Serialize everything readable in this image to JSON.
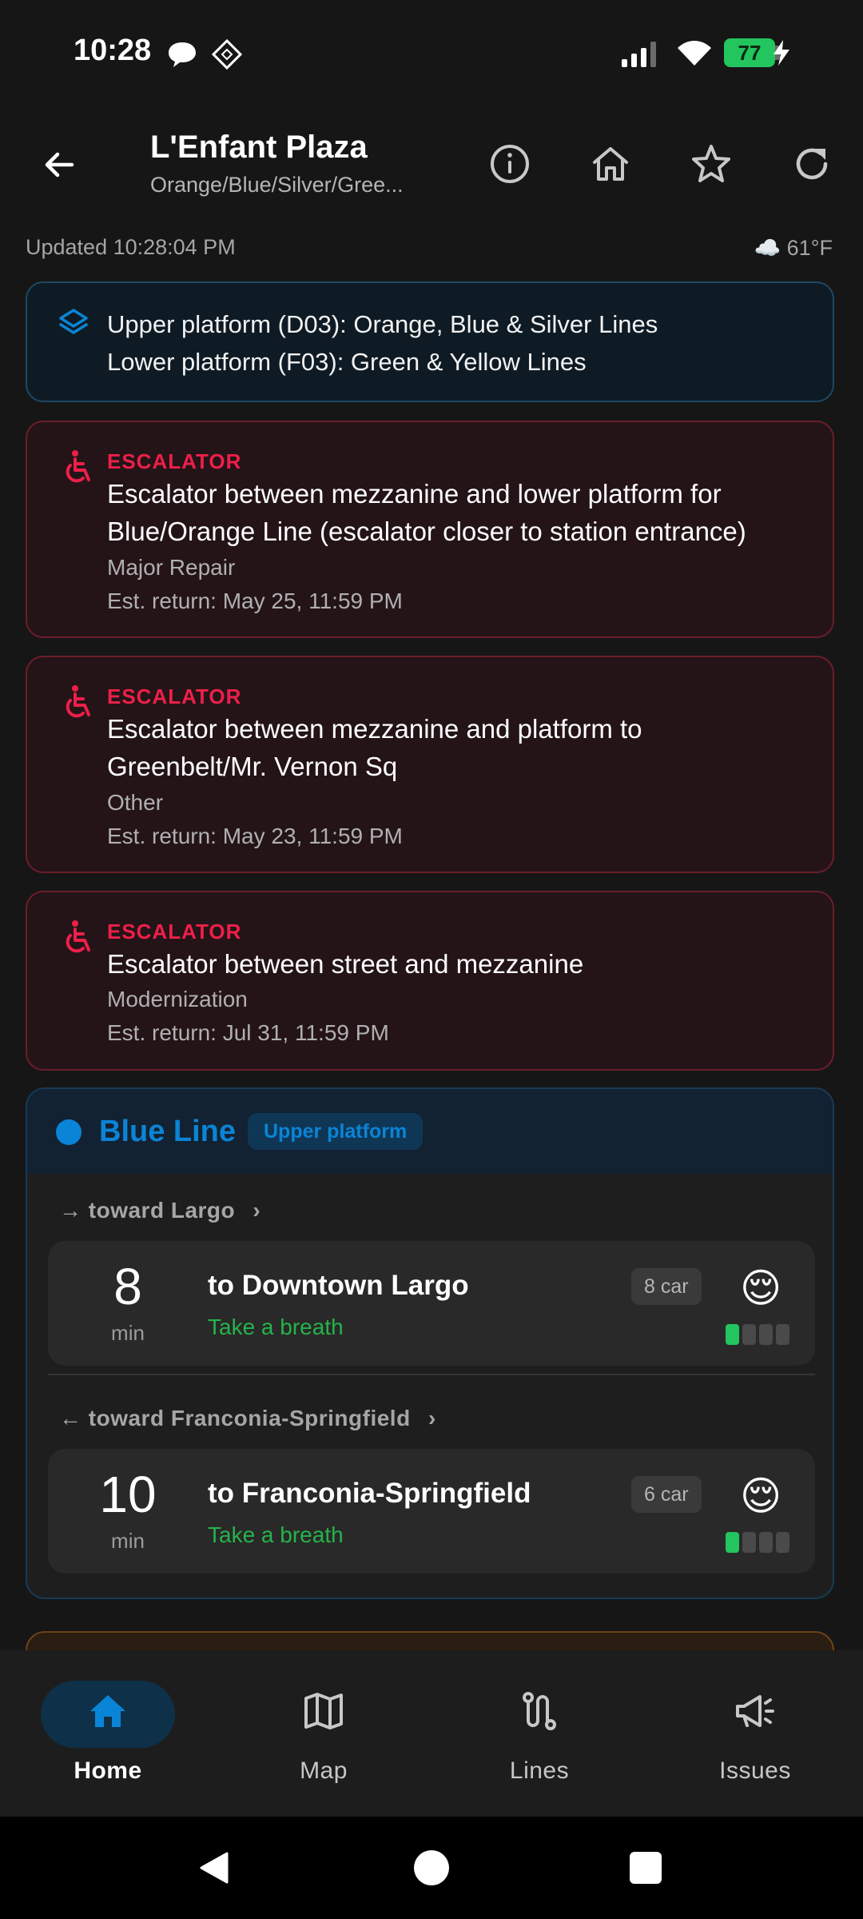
{
  "status_bar": {
    "time": "10:28",
    "battery": "77",
    "icons": [
      "chat-icon",
      "app-notification-icon",
      "signal-icon",
      "wifi-icon",
      "battery-icon",
      "charging-icon"
    ]
  },
  "app_bar": {
    "title": "L'Enfant Plaza",
    "subtitle": "Orange/Blue/Silver/Gree...",
    "actions": [
      "back-icon",
      "info-icon",
      "home-icon",
      "star-icon",
      "refresh-icon"
    ]
  },
  "updated_text": "Updated 10:28:04 PM",
  "weather": {
    "text": "☁️ 61°F"
  },
  "platform_info": {
    "lines": [
      "Upper platform (D03): Orange, Blue & Silver Lines",
      "Lower platform (F03): Green & Yellow Lines"
    ]
  },
  "alerts": [
    {
      "tag": "ESCALATOR",
      "desc1": "Escalator between mezzanine and lower platform for",
      "desc2": "Blue/Orange Line (escalator closer to station entrance)",
      "reason": "Major Repair",
      "eta": "Est. return: May 25, 11:59 PM"
    },
    {
      "tag": "ESCALATOR",
      "desc1": "Escalator between mezzanine and platform to",
      "desc2": "Greenbelt/Mr. Vernon Sq",
      "reason": "Other",
      "eta": "Est. return: May 23, 11:59 PM"
    },
    {
      "tag": "ESCALATOR",
      "desc1": "Escalator between street and mezzanine",
      "desc2": "",
      "reason": "Modernization",
      "eta": "Est. return: Jul 31, 11:59 PM"
    }
  ],
  "line_section": {
    "name": "Blue Line",
    "color": "#0a84d6",
    "badge": "Upper platform",
    "directions": [
      {
        "label": "→ toward Largo",
        "chevron": "›",
        "train": {
          "minutes": "8",
          "min_label": "min",
          "destination": "to Downtown Largo",
          "crowding": "Take a breath",
          "cars": "8 car",
          "emoji": "😌",
          "crowd_level": 1,
          "crowd_max": 4
        }
      },
      {
        "label": "← toward Franconia-Springfield",
        "chevron": "›",
        "train": {
          "minutes": "10",
          "min_label": "min",
          "destination": "to Franconia-Springfield",
          "crowding": "Take a breath",
          "cars": "6 car",
          "emoji": "😌",
          "crowd_level": 1,
          "crowd_max": 4
        }
      }
    ]
  },
  "bottom_nav": {
    "items": [
      {
        "label": "Home",
        "icon": "home-icon",
        "active": true
      },
      {
        "label": "Map",
        "icon": "map-icon",
        "active": false
      },
      {
        "label": "Lines",
        "icon": "route-icon",
        "active": false
      },
      {
        "label": "Issues",
        "icon": "megaphone-icon",
        "active": false
      }
    ]
  },
  "system_nav": [
    "back-triangle-icon",
    "home-circle-icon",
    "recents-square-icon"
  ],
  "colors": {
    "background": "#161616",
    "alert_red": "#ee1f4a",
    "blue_line": "#0a84d6",
    "crowd_green": "#22c55e"
  }
}
